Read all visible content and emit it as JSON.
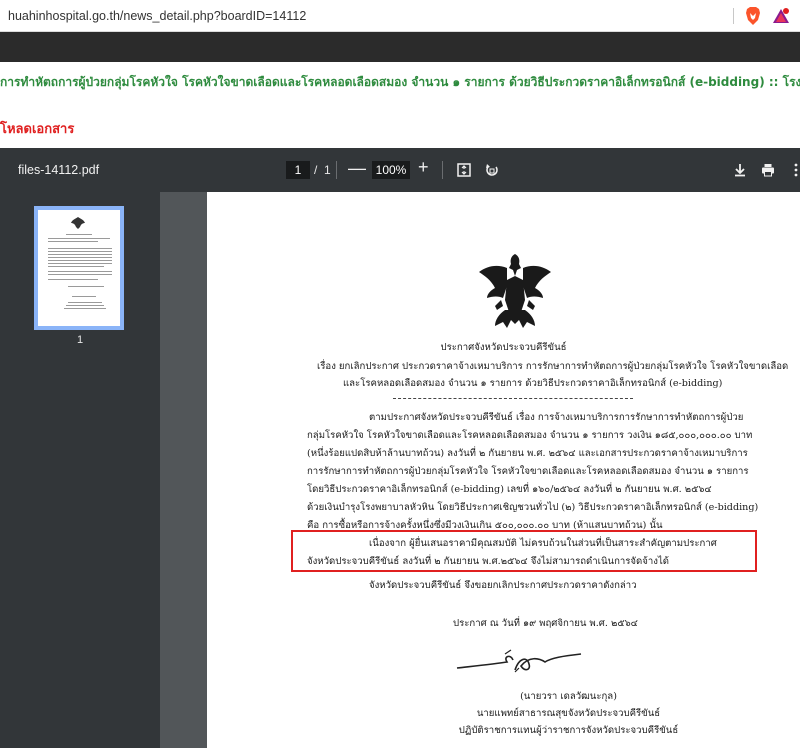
{
  "browser": {
    "url": "huahinhospital.go.th/news_detail.php?boardID=14112",
    "brave_icon": "brave-lion-icon",
    "extension_icon": "rewards-triangle-icon"
  },
  "page_heading": "การทำหัตถการผู้ป่วยกลุ่มโรคหัวใจ โรคหัวใจขาดเลือดและโรคหลอดเลือดสมอง จำนวน ๑ รายการ ด้วยวิธีประกวดราคาอิเล็กทรอนิกส์ (e-bidding) :: โรงพยาบาลหัวหิน จังหวัด",
  "download_label": "โหลดเอกสาร",
  "pdf": {
    "filename": "files-14112.pdf",
    "current_page": "1",
    "separator": "/",
    "total_pages": "1",
    "zoom_minus": "—",
    "zoom": "100%",
    "zoom_plus": "+",
    "thumbnail_label": "1",
    "icons": [
      "fit-page-icon",
      "rotate-icon",
      "download-icon",
      "print-icon",
      "more-vert-icon"
    ]
  },
  "document": {
    "announcement": "ประกาศจังหวัดประจวบคีรีขันธ์",
    "subject_line1": "เรื่อง  ยกเลิกประกาศ ประกวดราคาจ้างเหมาบริการ การรักษาการทำหัตถการผู้ป่วยกลุ่มโรคหัวใจ โรคหัวใจขาดเลือด",
    "subject_line2": "และโรคหลอดเลือดสมอง  จำนวน ๑ รายการ ด้วยวิธีประกวดราคาอิเล็กทรอนิกส์ (e-bidding)",
    "body_lines": [
      "ตามประกาศจังหวัดประจวบคีรีขันธ์ เรื่อง การจ้างเหมาบริการการรักษาการทำหัตถการผู้ป่วย",
      "กลุ่มโรคหัวใจ โรคหัวใจขาดเลือดและโรคหลอดเลือดสมอง จำนวน ๑ รายการ วงเงิน ๑๘๕,๐๐๐,๐๐๐.๐๐ บาท",
      "(หนึ่งร้อยแปดสิบห้าล้านบาทถ้วน)  ลงวันที่ ๒ กันยายน พ.ศ. ๒๕๖๔  และเอกสารประกวดราคาจ้างเหมาบริการ",
      "การรักษาการทำหัตถการผู้ป่วยกลุ่มโรคหัวใจ โรคหัวใจขาดเลือดและโรคหลอดเลือดสมอง จำนวน ๑ รายการ",
      "โดยวิธีประกวดราคาอิเล็กทรอนิกส์ (e-bidding) เลขที่ ๑๖๐/๒๕๖๔ ลงวันที่ ๒ กันยายน พ.ศ. ๒๕๖๔",
      "ด้วยเงินบำรุงโรงพยาบาลหัวหิน โดยวิธีประกาศเชิญชวนทั่วไป (๒) วิธีประกวดราคาอิเล็กทรอนิกส์ (e-bidding)",
      "คือ การซื้อหรือการจ้างครั้งหนึ่งซึ่งมีวงเงินเกิน ๕๐๐,๐๐๐.๐๐ บาท (ห้าแสนบาทถ้วน) นั้น"
    ],
    "highlight_line1": "เนื่องจาก ผู้ยื่นเสนอราคามีคุณสมบัติ ไม่ครบถ้วนในส่วนที่เป็นสาระสำคัญตามประกาศ",
    "highlight_line2": "จังหวัดประจวบคีรีขันธ์ ลงวันที่ ๒ กันยายน พ.ศ.๒๕๖๔ จึงไม่สามารถดำเนินการจัดจ้างได้",
    "cancel_line": "จังหวัดประจวบคีรีขันธ์ จึงขอยกเลิกประกาศประกวดราคาดังกล่าว",
    "date_line": "ประกาศ   ณ  วันที่ ๑๙  พฤศจิกายน พ.ศ. ๒๕๖๔",
    "signatory_name": "(นายวรา  เดลวัฒนะกุล)",
    "signatory_title": "นายแพทย์สาธารณสุขจังหวัดประจวบคีรีขันธ์",
    "signatory_role": "ปฏิบัติราชการแทนผู้ว่าราชการจังหวัดประจวบคีรีขันธ์"
  }
}
